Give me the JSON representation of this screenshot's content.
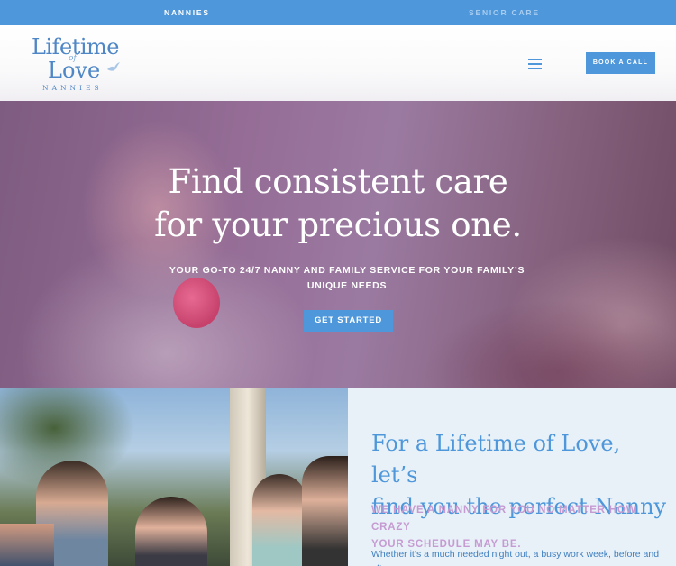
{
  "topbar": {
    "tabs": [
      {
        "label": "NANNIES",
        "active": true
      },
      {
        "label": "SENIOR CARE",
        "active": false
      }
    ]
  },
  "header": {
    "logo": {
      "line1": "Lifetime",
      "line_of": "of",
      "line2": "Love",
      "line3": "NANNIES"
    },
    "menu_icon": "hamburger-menu-icon",
    "book_button": "BOOK A CALL"
  },
  "hero": {
    "title_line1": "Find consistent care",
    "title_line2": "for your precious one.",
    "subtitle_line1": "YOUR GO-TO 24/7 NANNY AND FAMILY SERVICE FOR YOUR FAMILY’S",
    "subtitle_line2": "UNIQUE NEEDS",
    "cta": "GET STARTED"
  },
  "about": {
    "title_line1": "For a Lifetime of Love, let’s",
    "title_line2": "find you the perfect Nanny",
    "subtitle_line1": "WE HAVE A NANNY FOR YOU NO MATTER HOW CRAZY",
    "subtitle_line2": "YOUR SCHEDULE MAY BE.",
    "body": "Whether it’s a much needed night out, a busy work week, before and after"
  },
  "colors": {
    "brand_blue": "#4e97da",
    "hero_purple": "#956d96",
    "accent_lilac": "#c69bd2",
    "panel_bg": "#e8f1f8"
  }
}
